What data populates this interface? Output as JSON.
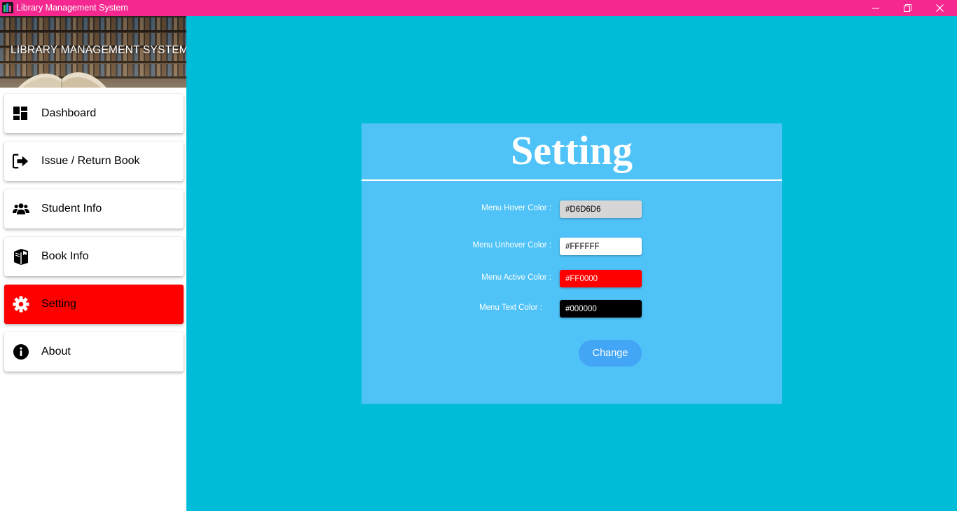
{
  "window": {
    "title": "Library Management System",
    "titlebar_color": "#F4288E",
    "controls": {
      "minimize": "minimize-icon",
      "restore": "restore-icon",
      "close": "close-icon"
    }
  },
  "sidebar": {
    "banner_title": "LIBRARY MANAGEMENT SYSTEM",
    "items": [
      {
        "label": "Dashboard",
        "icon": "dashboard-icon",
        "active": false
      },
      {
        "label": "Issue / Return Book",
        "icon": "sign-out-icon",
        "active": false
      },
      {
        "label": "Student Info",
        "icon": "users-icon",
        "active": false
      },
      {
        "label": "Book Info",
        "icon": "books-icon",
        "active": false
      },
      {
        "label": "Setting",
        "icon": "gear-icon",
        "active": true
      },
      {
        "label": "About",
        "icon": "info-icon",
        "active": false
      }
    ]
  },
  "main": {
    "background_color": "#00BCD8",
    "panel": {
      "title": "Setting",
      "background_color": "#4FC3F7",
      "fields": [
        {
          "label": "Menu Hover Color :",
          "value": "#D6D6D6"
        },
        {
          "label": "Menu Unhover Color :",
          "value": "#FFFFFF"
        },
        {
          "label": "Menu Active Color :",
          "value": "#FF0000"
        },
        {
          "label": "Menu Text Color :",
          "value": "#000000"
        }
      ],
      "change_button": "Change"
    }
  }
}
